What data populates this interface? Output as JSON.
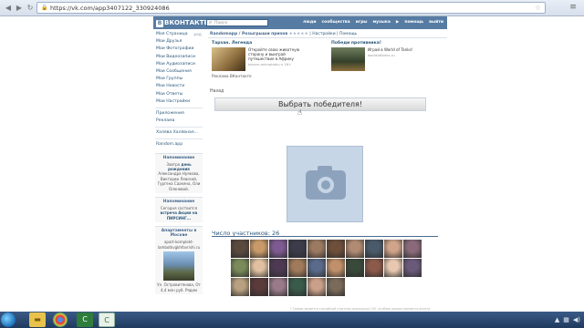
{
  "browser": {
    "url": "https://vk.com/app3407122_330924086"
  },
  "vk": {
    "logo": "ВКОНТАКТЕ",
    "logo_letter": "В",
    "search_placeholder": "Поиск",
    "nav": [
      "люди",
      "сообщества",
      "игры",
      "музыка",
      "помощь",
      "выйти"
    ]
  },
  "sidebar": {
    "items": [
      {
        "label": "Моя Страница",
        "count": "ред."
      },
      {
        "label": "Мои Друзья",
        "count": ""
      },
      {
        "label": "Мои Фотографии",
        "count": ""
      },
      {
        "label": "Мои Видеозаписи",
        "count": ""
      },
      {
        "label": "Мои Аудиозаписи",
        "count": ""
      },
      {
        "label": "Мои Сообщения",
        "count": ""
      },
      {
        "label": "Мои Группы",
        "count": ""
      },
      {
        "label": "Мои Новости",
        "count": ""
      },
      {
        "label": "Мои Ответы",
        "count": ""
      },
      {
        "label": "Мои Настройки",
        "count": ""
      }
    ],
    "items2": [
      "Приложения",
      "Реклама"
    ],
    "items3": [
      "Халява Халявная..."
    ],
    "items4": [
      "Random.app"
    ],
    "reminder1": {
      "title": "Напоминание",
      "text_pre": "Завтра",
      "highlight": "день рождения",
      "text_post": "Александра Нуякова, Виктории Левской, Гургена Саакяна, Оли Оленевой."
    },
    "reminder2": {
      "title": "Напоминание",
      "text_pre": "Сегодня состоится",
      "highlight": "встреча Акция на ПИРСИНГ...",
      "text_post": ""
    },
    "ad": {
      "title": "Апартаменты в Москве",
      "source": "apart-komplekt-lambotkvgkhfovrishi.ru",
      "caption": "Ул. Островитянова, От 4,4 млн руб. Рядом"
    }
  },
  "main": {
    "crumbs_app": "Randomapp / Розыгрыши призов",
    "crumbs_stars": "★★★★★",
    "crumbs_settings": "Настройки",
    "crumbs_help": "Помощь",
    "promo1": {
      "title": "Тарзан. Легенда",
      "text": "Откройте свою животную сторону и выиграй путешествие в Африку",
      "src": "tarzan-animalads.ru  16+"
    },
    "promo2": {
      "title": "Победи противника!",
      "text": "Играй в World of Tanks!",
      "src": "worldoftanks.ru"
    },
    "promo_footer": "Реклама ВКонтакте",
    "back": "Назад",
    "winner_button": "Выбрать победителя!",
    "participants_label": "Число участников: 26",
    "footnote": "* Сервис является случайный участник розыгрыша 100, за обзор предоставляется оплата."
  },
  "colors": {
    "vk_blue": "#577ca3",
    "link": "#2b587a",
    "photo_bg": "#c7d6e6"
  },
  "participant_photos": [
    "#5a4a3e",
    "#c89a6a",
    "#7d5a8f",
    "#3b3b4a",
    "#9c7a62",
    "#6e4f3a",
    "#b08b72",
    "#4a5a6a",
    "#d0a48a",
    "#8a6a7a",
    "#7a8a5a",
    "#e0c0a0",
    "#4d3a52",
    "#a07a5a",
    "#5a6a8a",
    "#c0906a",
    "#3a4a3a",
    "#8c5a4a",
    "#e8c8b0",
    "#6a5a7a",
    "#b8a080",
    "#5a3a3a",
    "#9a7a8a",
    "#3a5a4a",
    "#caa08a",
    "#7a6a5a"
  ]
}
